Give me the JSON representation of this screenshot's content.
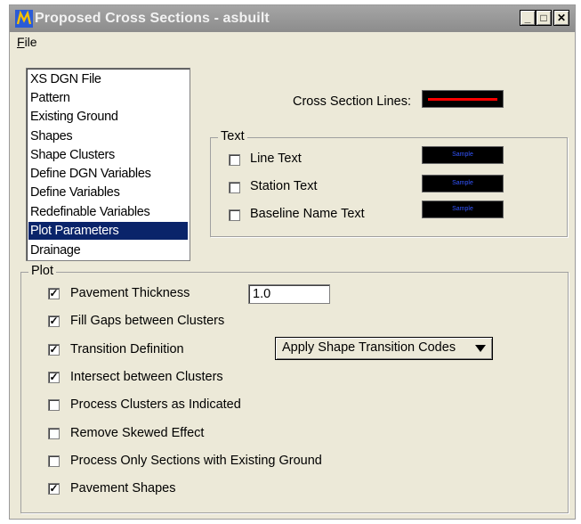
{
  "window": {
    "title": "Proposed Cross Sections - asbuilt",
    "icon": "microstation-icon"
  },
  "window_buttons": {
    "minimize": "_",
    "maximize": "□",
    "close": "✕"
  },
  "menu": {
    "file_label": "File",
    "file_accel": "F",
    "file_rest": "ile"
  },
  "list": {
    "items": [
      "XS DGN File",
      "Pattern",
      "Existing Ground",
      "Shapes",
      "Shape Clusters",
      "Define DGN Variables",
      "Define Variables",
      "Redefinable Variables",
      "Plot Parameters",
      "Drainage"
    ],
    "selected": "Plot Parameters"
  },
  "cross_section_lines": {
    "label": "Cross Section Lines:",
    "color": "#ff0000"
  },
  "text_group": {
    "title": "Text",
    "items": [
      {
        "label": "Line Text",
        "checked": false
      },
      {
        "label": "Station Text",
        "checked": false
      },
      {
        "label": "Baseline Name Text",
        "checked": false
      }
    ],
    "swatch_sample": "Sample"
  },
  "plot_group": {
    "title": "Plot",
    "pavement_thickness_value": "1.0",
    "transition_dropdown": "Apply Shape Transition Codes",
    "items": [
      {
        "label": "Pavement Thickness",
        "checked": true
      },
      {
        "label": "Fill Gaps between Clusters",
        "checked": true
      },
      {
        "label": "Transition Definition",
        "checked": true
      },
      {
        "label": "Intersect between Clusters",
        "checked": true
      },
      {
        "label": "Process Clusters as Indicated",
        "checked": false
      },
      {
        "label": "Remove Skewed Effect",
        "checked": false
      },
      {
        "label": "Process Only Sections with Existing Ground",
        "checked": false
      },
      {
        "label": "Pavement Shapes",
        "checked": true
      }
    ]
  },
  "colors": {
    "selection": "#0a246a",
    "dialog_bg": "#ece9d8"
  }
}
